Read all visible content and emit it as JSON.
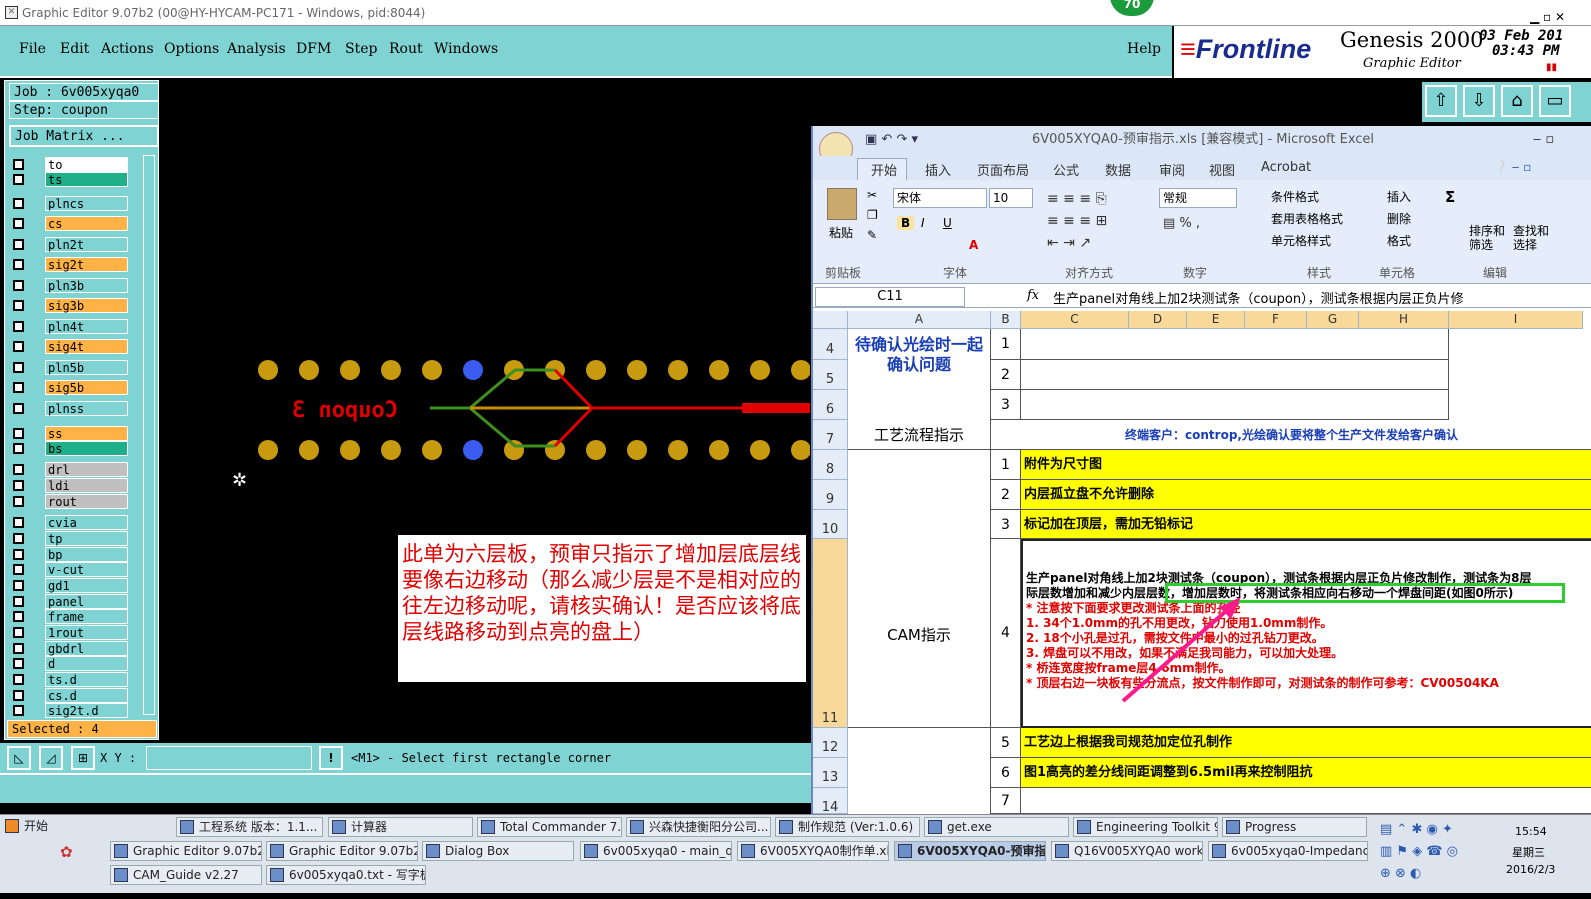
{
  "genesis": {
    "title": "Graphic Editor 9.07b2 (00@HY-HYCAM-PC171 - Windows, pid:8044)",
    "badge": "70",
    "menu": [
      "File",
      "Edit",
      "Actions",
      "Options",
      "Analysis",
      "DFM",
      "Step",
      "Rout",
      "Windows"
    ],
    "help": "Help",
    "brand": {
      "logo": "Frontline",
      "product": "Genesis 2000",
      "sub": "Graphic Editor",
      "date": "03 Feb 201",
      "time": "03:43 PM"
    },
    "job": "Job : 6v005xyqa0",
    "step": "Step: coupon",
    "job_matrix": "Job Matrix ...",
    "layers": [
      {
        "name": "to",
        "color": "#ffffff"
      },
      {
        "name": "ts",
        "color": "#1fb08a"
      },
      {
        "name": "plncs",
        "color": "#7fd3d3"
      },
      {
        "name": "cs",
        "color": "#ffb347"
      },
      {
        "name": "pln2t",
        "color": "#7fd3d3"
      },
      {
        "name": "sig2t",
        "color": "#ffb347"
      },
      {
        "name": "pln3b",
        "color": "#7fd3d3"
      },
      {
        "name": "sig3b",
        "color": "#ffb347"
      },
      {
        "name": "pln4t",
        "color": "#7fd3d3"
      },
      {
        "name": "sig4t",
        "color": "#ffb347"
      },
      {
        "name": "pln5b",
        "color": "#7fd3d3"
      },
      {
        "name": "sig5b",
        "color": "#ffb347"
      },
      {
        "name": "plnss",
        "color": "#7fd3d3"
      },
      {
        "name": "ss",
        "color": "#ffb347"
      },
      {
        "name": "bs",
        "color": "#1fb08a"
      },
      {
        "name": "drl",
        "color": "#c0c0c0"
      },
      {
        "name": "ldi",
        "color": "#c0c0c0"
      },
      {
        "name": "rout",
        "color": "#c0c0c0"
      },
      {
        "name": "cvia",
        "color": "#7fd3d3"
      },
      {
        "name": "tp",
        "color": "#7fd3d3"
      },
      {
        "name": "bp",
        "color": "#7fd3d3"
      },
      {
        "name": "v-cut",
        "color": "#7fd3d3"
      },
      {
        "name": "gd1",
        "color": "#7fd3d3"
      },
      {
        "name": "panel",
        "color": "#7fd3d3"
      },
      {
        "name": "frame",
        "color": "#7fd3d3"
      },
      {
        "name": "1rout",
        "color": "#7fd3d3"
      },
      {
        "name": "gbdrl",
        "color": "#7fd3d3"
      },
      {
        "name": "d",
        "color": "#7fd3d3"
      },
      {
        "name": "ts.d",
        "color": "#7fd3d3"
      },
      {
        "name": "cs.d",
        "color": "#7fd3d3"
      },
      {
        "name": "sig2t.d",
        "color": "#7fd3d3"
      }
    ],
    "selected": "Selected : 4",
    "coupon_text": "Coupon 3",
    "xy_label": "X Y :",
    "xy_value": "",
    "prompt": "<M1> - Select first rectangle corner",
    "note": "此单为六层板，预审只指示了增加层底层线要像右边移动（那么减少层是不是相对应的往左边移动呢，请核实确认！是否应该将底层线路移动到点亮的盘上）"
  },
  "excel": {
    "title": "6V005XYQA0-预审指示.xls [兼容模式] - Microsoft Excel",
    "tabs": [
      "开始",
      "插入",
      "页面布局",
      "公式",
      "数据",
      "审阅",
      "视图",
      "Acrobat"
    ],
    "ribbon": {
      "paste": "粘贴",
      "clipboard": "剪贴板",
      "font_name": "宋体",
      "font_size": "10",
      "font": "字体",
      "align": "对齐方式",
      "numfmt": "常规",
      "number": "数字",
      "cond": "条件格式",
      "table": "套用表格格式",
      "cellstyle": "单元格样式",
      "styles": "样式",
      "insert": "插入",
      "delete": "删除",
      "format": "格式",
      "cells": "单元格",
      "sort": "排序和筛选",
      "find": "查找和选择",
      "edit": "编辑"
    },
    "cellref": "C11",
    "formula": "生产panel对角线上加2块测试条（coupon），测试条根据内层正负片修",
    "cols": [
      "A",
      "B",
      "C",
      "D",
      "E",
      "F",
      "G",
      "H",
      "I"
    ],
    "rows": {
      "confirm": "待确认光绘时一起确认问题",
      "flow": "工艺流程指示",
      "customer": "终端客户：controp,光绘确认要将整个生产文件发给客户确认",
      "cam": "CAM指示",
      "i1": "附件为尺寸图",
      "i2": "内层孤立盘不允许删除",
      "i3": "标记加在顶层，需加无铅标记",
      "i4": [
        "生产panel对角线上加2块测试条（coupon），测试条根据内层正负片修改制作，测试条为8层",
        "际层数增加和减少内层层数，增加层数时，将测试条相应向右移动一个焊盘间距(如图0所示)"
      ],
      "i4red": [
        "* 注意按下面要求更改测试条上面的孔径",
        "1.   34个1.0mm的孔不用更改，钻刀使用1.0mm制作。",
        "2.   18个小孔是过孔，需按文件中最小的过孔钻刀更改。",
        "3.   焊盘可以不用改，如果不满足我司能力，可以加大处理。",
        "*  桥连宽度按frame层4.6mm制作。",
        "*  顶层右边一块板有些分流点，按文件制作即可，对测试条的制作可参考：CV00504KA"
      ],
      "i5": "工艺边上根据我司规范加定位孔制作",
      "i6": "图1高亮的差分线间距调整到6.5mil再来控制阻抗",
      "rownums": [
        "4",
        "5",
        "6",
        "7",
        "8",
        "9",
        "10",
        "11",
        "12",
        "13",
        "14"
      ],
      "subnums": [
        "1",
        "2",
        "3",
        "1",
        "2",
        "3",
        "4",
        "5",
        "6",
        "7"
      ]
    }
  },
  "taskbar": {
    "start": "开始",
    "row1": [
      "工程系统 版本：1.1...",
      "计算器",
      "Total Commander 7.0 ...",
      "兴森快捷衡阳分公司...",
      "制作规范 (Ver:1.0.6)",
      "get.exe",
      "Engineering Toolkit 9.0...",
      "Progress"
    ],
    "row2": [
      "Graphic Editor 9.07b2 (0...",
      "Graphic Editor 9.07b2 (0...",
      "Dialog Box",
      "6v005xyqa0 - main_qa",
      "6V005XYQA0制作单.xls ...",
      "6V005XYQA0-预审指...",
      "Q16V005XYQA0 working...",
      "6v005xyqa0-Impedance..."
    ],
    "row3": [
      "CAM_Guide v2.27",
      "6v005xyqa0.txt - 写字板"
    ],
    "time": "15:54",
    "weekday": "星期三",
    "date": "2016/2/3"
  }
}
